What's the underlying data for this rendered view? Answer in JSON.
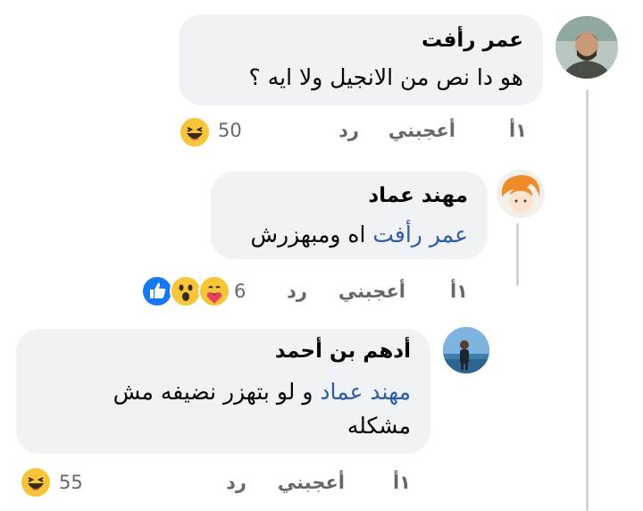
{
  "comments": [
    {
      "author": "عمر رأفت",
      "text": "هو دا نص من الانجيل ولا ايه ؟",
      "time": "١أ",
      "like": "أعجبني",
      "reply": "رد",
      "reaction_count": "50",
      "reactions": [
        "laugh-emoji"
      ]
    },
    {
      "author": "مهند عماد",
      "mention": "عمر رأفت",
      "text": "اه ومبهزرش",
      "time": "١أ",
      "like": "أعجبني",
      "reply": "رد",
      "reaction_count": "6",
      "reactions": [
        "care-emoji",
        "wow-emoji",
        "like-emoji"
      ]
    },
    {
      "author": "أدهم بن أحمد",
      "mention": "مهند عماد",
      "text_line1": "و لو بتهزر نضيفه مش",
      "text_line2": "مشكله",
      "time": "١أ",
      "like": "أعجبني",
      "reply": "رد",
      "reaction_count": "55",
      "reactions": [
        "laugh-emoji"
      ]
    }
  ],
  "colors": {
    "bubble": "#f0f2f5",
    "mention": "#2d5ca7",
    "meta": "#65676b",
    "laugh_emoji": "#f7c53a",
    "like_emoji": "#1877f2"
  }
}
